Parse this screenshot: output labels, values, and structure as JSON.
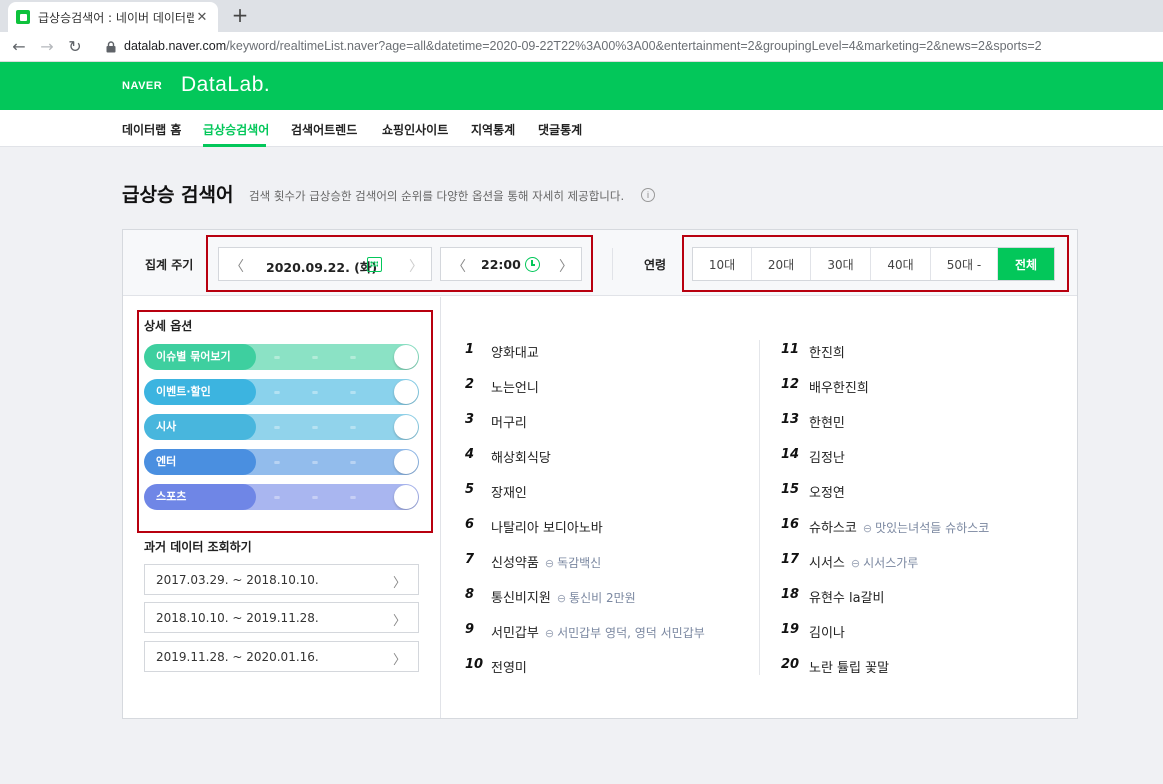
{
  "browser": {
    "tab_title": "급상승검색어 : 네이버 데이터랩",
    "tab_close": "✕",
    "new_tab": "+",
    "url_host": "datalab.naver.com",
    "url_path": "/keyword/realtimeList.naver?age=all&datetime=2020-09-22T22%3A00%3A00&entertainment=2&groupingLevel=4&marketing=2&news=2&sports=2"
  },
  "header": {
    "brand_naver": "NAVER",
    "brand_datalab": "DataLab."
  },
  "subnav": {
    "items": [
      "데이터랩 홈",
      "급상승검색어",
      "검색어트렌드",
      "쇼핑인사이트",
      "지역통계",
      "댓글통계"
    ],
    "active": "급상승검색어"
  },
  "page": {
    "title": "급상승 검색어",
    "description": "검색 횟수가 급상승한 검색어의 순위를 다양한 옵션을 통해 자세히 제공합니다.",
    "info_icon": "i"
  },
  "filters": {
    "period_label": "집계 주기",
    "date": "2020.09.22. (화)",
    "time": "22:00",
    "age_label": "연령",
    "ages": [
      "10대",
      "20대",
      "30대",
      "40대",
      "50대 -",
      "전체"
    ],
    "age_selected": "전체"
  },
  "options": {
    "title": "상세 옵션",
    "toggles": [
      {
        "label": "이슈별 묶어보기",
        "on": true,
        "color": "#3ecf9f"
      },
      {
        "label": "이벤트·할인",
        "on": true,
        "color": "#3cb4e0"
      },
      {
        "label": "시사",
        "on": true,
        "color": "#48b6dd"
      },
      {
        "label": "엔터",
        "on": true,
        "color": "#4a8fe0"
      },
      {
        "label": "스포츠",
        "on": true,
        "color": "#6f86e6"
      }
    ]
  },
  "past": {
    "title": "과거 데이터 조회하기",
    "ranges": [
      "2017.03.29. ~ 2018.10.10.",
      "2018.10.10. ~ 2019.11.28.",
      "2019.11.28. ~ 2020.01.16."
    ]
  },
  "ranking": [
    {
      "rank": "1",
      "keyword": "양화대교",
      "related": ""
    },
    {
      "rank": "2",
      "keyword": "노는언니",
      "related": ""
    },
    {
      "rank": "3",
      "keyword": "머구리",
      "related": ""
    },
    {
      "rank": "4",
      "keyword": "해상회식당",
      "related": ""
    },
    {
      "rank": "5",
      "keyword": "장재인",
      "related": ""
    },
    {
      "rank": "6",
      "keyword": "나탈리아 보디아노바",
      "related": ""
    },
    {
      "rank": "7",
      "keyword": "신성약품",
      "related": "독감백신"
    },
    {
      "rank": "8",
      "keyword": "통신비지원",
      "related": "통신비 2만원"
    },
    {
      "rank": "9",
      "keyword": "서민갑부",
      "related": "서민갑부 영덕, 영덕 서민갑부"
    },
    {
      "rank": "10",
      "keyword": "전영미",
      "related": ""
    },
    {
      "rank": "11",
      "keyword": "한진희",
      "related": ""
    },
    {
      "rank": "12",
      "keyword": "배우한진희",
      "related": ""
    },
    {
      "rank": "13",
      "keyword": "한현민",
      "related": ""
    },
    {
      "rank": "14",
      "keyword": "김정난",
      "related": ""
    },
    {
      "rank": "15",
      "keyword": "오정연",
      "related": ""
    },
    {
      "rank": "16",
      "keyword": "슈하스코",
      "related": "맛있는녀석들 슈하스코"
    },
    {
      "rank": "17",
      "keyword": "시서스",
      "related": "시서스가루"
    },
    {
      "rank": "18",
      "keyword": "유현수 la갈비",
      "related": ""
    },
    {
      "rank": "19",
      "keyword": "김이나",
      "related": ""
    },
    {
      "rank": "20",
      "keyword": "노란 튤립 꽃말",
      "related": ""
    }
  ]
}
